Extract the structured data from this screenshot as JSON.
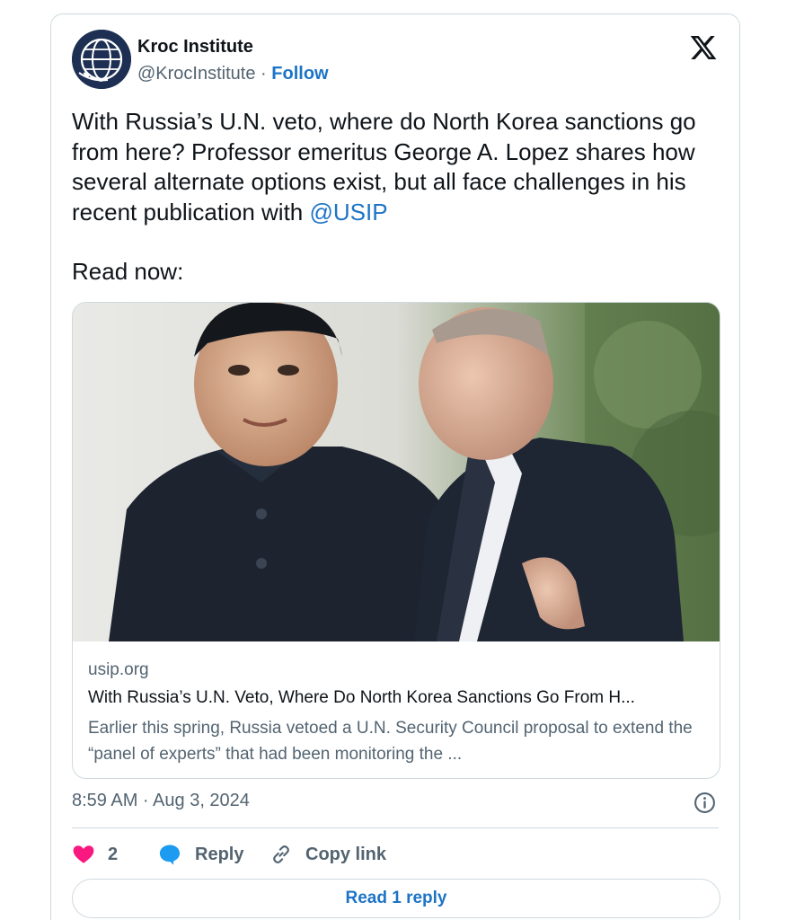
{
  "author": {
    "name": "Kroc Institute",
    "handle": "@KrocInstitute",
    "separator": "·",
    "follow_label": "Follow",
    "avatar_icon": "globe-olive-branch-logo"
  },
  "tweet": {
    "text_before_mention": "With Russia’s U.N. veto, where do North Korea sanctions go from here? Professor emeritus George A. Lopez shares how several alternate options exist, but all face challenges in his recent publication with ",
    "mention": "@USIP",
    "read_now": "Read now:"
  },
  "link_card": {
    "domain": "usip.org",
    "title": "With Russia’s U.N. Veto, Where Do North Korea Sanctions Go From H...",
    "description": "Earlier this spring, Russia vetoed a U.N. Security Council proposal to extend the “panel of experts” that had been monitoring the ..."
  },
  "meta": {
    "timestamp": "8:59 AM · Aug 3, 2024"
  },
  "actions": {
    "like_count": "2",
    "reply_label": "Reply",
    "copy_link_label": "Copy link",
    "read_replies_label": "Read 1 reply"
  },
  "colors": {
    "accent": "#1d74c6",
    "heart": "#f91880",
    "reply_bubble": "#1d9bf0",
    "secondary_text": "#536471",
    "border": "#cfd9de"
  }
}
